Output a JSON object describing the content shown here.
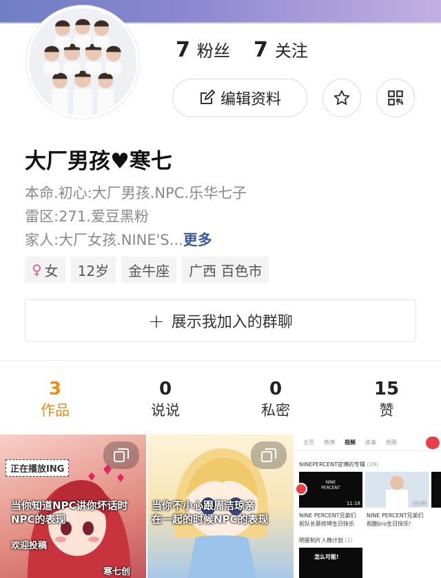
{
  "profile": {
    "fans_count": "7",
    "fans_label": "粉丝",
    "following_count": "7",
    "following_label": "关注",
    "edit_label": "编辑资料",
    "name": "大厂男孩♥寒七",
    "bio_line1": "本命.初心:大厂男孩.NPC.乐华七子",
    "bio_line2": "雷区:271.爱豆黑粉",
    "bio_line3": "家人:大厂女孩.NINE'S...",
    "bio_more": "更多",
    "tags": {
      "gender_symbol": "♀",
      "gender": "女",
      "age": "12岁",
      "zodiac": "金牛座",
      "location": "广西 百色市"
    },
    "group_button": "展示我加入的群聊",
    "group_plus": "+"
  },
  "stats": [
    {
      "num": "3",
      "label": "作品"
    },
    {
      "num": "0",
      "label": "说说"
    },
    {
      "num": "0",
      "label": "私密"
    },
    {
      "num": "15",
      "label": "赞"
    }
  ],
  "thumbs": {
    "t1_tag": "正在播放ING",
    "t1_caption1": "当你知道NPC讲你坏话时",
    "t1_caption2": "NPC的表现",
    "t1_caption3": "欢迎投稿",
    "t1_sign": "寒七创",
    "t2_caption1": "当你不小心跟周洁琼亲",
    "t2_caption2": "在一起的时候NPC的表现",
    "t3_nav": [
      "主页",
      "微博",
      "视频",
      "故事",
      "相册"
    ],
    "t3_section1": "NINEPERCENT官博的专辑",
    "t3_section1_count": "(29)",
    "t3_logo": "NINE PERCENT",
    "t3_time1": "11:18",
    "t3_time2": "11:45",
    "t3_cap1a": "NINE PERCENT兄弟们",
    "t3_cap1b": "祝队长蔡徐坤生日快乐",
    "t3_cap2a": "NINE PERCENT兄弟们",
    "t3_cap2b": "祝酷bro生日快乐!",
    "t3_section2": "明星制片人微计划",
    "t3_section2_count": "(1)",
    "t3_box3": "怎么可能!"
  },
  "colors": {
    "accent": "#f08a10",
    "link": "#3a5a9c",
    "female": "#e8578d"
  }
}
